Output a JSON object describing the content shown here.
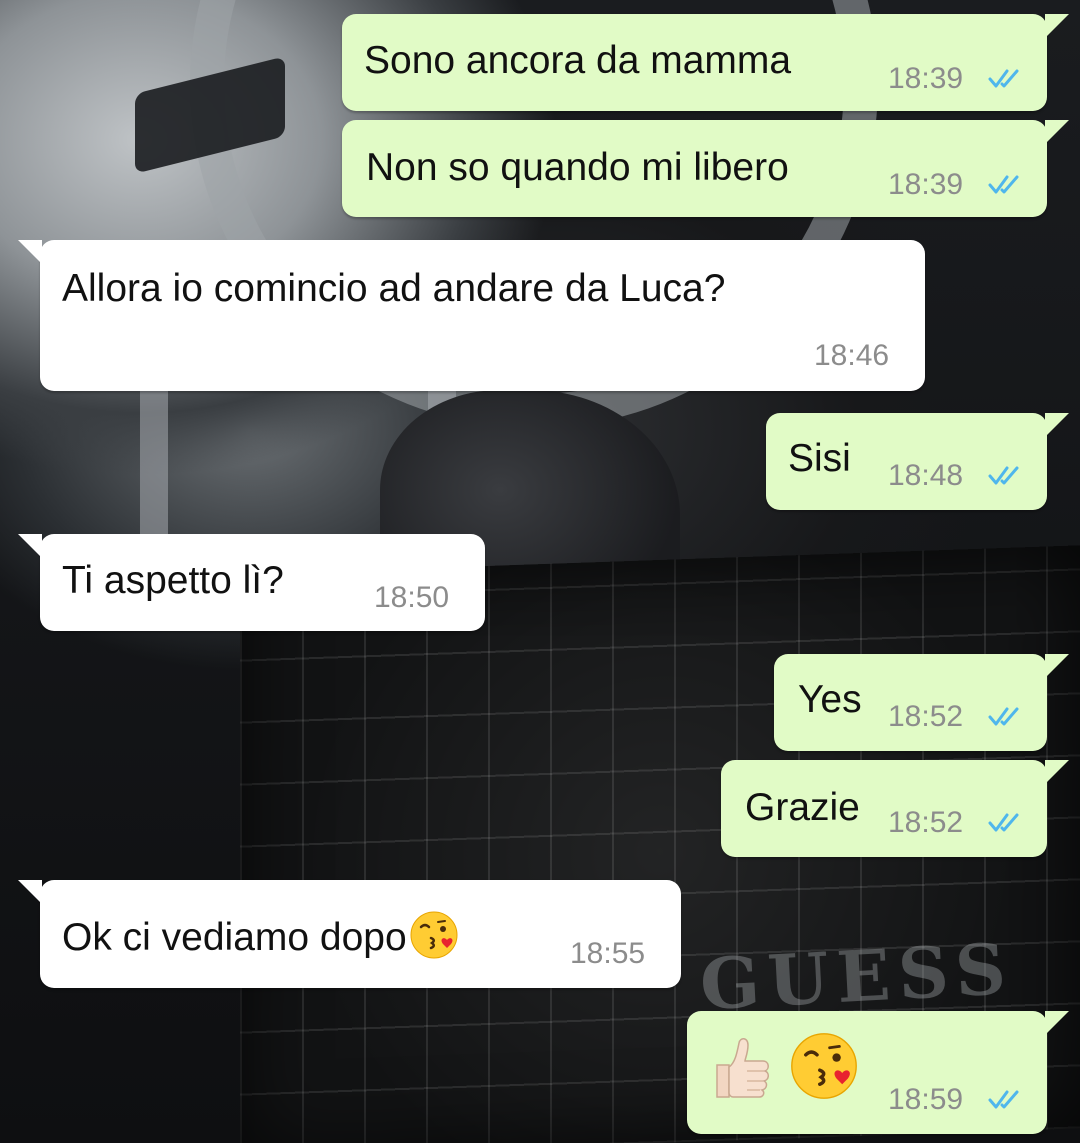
{
  "messages": [
    {
      "id": 1,
      "direction": "out",
      "text": "Sono ancora da mamma",
      "time": "18:39",
      "status": "read"
    },
    {
      "id": 2,
      "direction": "out",
      "text": "Non so quando mi libero",
      "time": "18:39",
      "status": "read"
    },
    {
      "id": 3,
      "direction": "in",
      "text": "Allora io comincio ad andare da Luca?",
      "time": "18:46"
    },
    {
      "id": 4,
      "direction": "out",
      "text": "Sisi",
      "time": "18:48",
      "status": "read"
    },
    {
      "id": 5,
      "direction": "in",
      "text": "Ti aspetto lì?",
      "time": "18:50"
    },
    {
      "id": 6,
      "direction": "out",
      "text": "Yes",
      "time": "18:52",
      "status": "read"
    },
    {
      "id": 7,
      "direction": "out",
      "text": "Grazie",
      "time": "18:52",
      "status": "read"
    },
    {
      "id": 8,
      "direction": "in",
      "text": "Ok ci vediamo dopo",
      "emoji": "face-blowing-a-kiss",
      "time": "18:55"
    },
    {
      "id": 9,
      "direction": "out",
      "emoji": [
        "thumbs-up-light-skin-tone",
        "face-blowing-a-kiss"
      ],
      "time": "18:59",
      "status": "read"
    }
  ],
  "wallpaper": {
    "logo_text": "GUESS"
  },
  "colors": {
    "outgoing_bubble": "#e1fbc6",
    "incoming_bubble": "#ffffff",
    "read_ticks": "#4fb6ec",
    "timestamp": "#8c8c8c"
  }
}
